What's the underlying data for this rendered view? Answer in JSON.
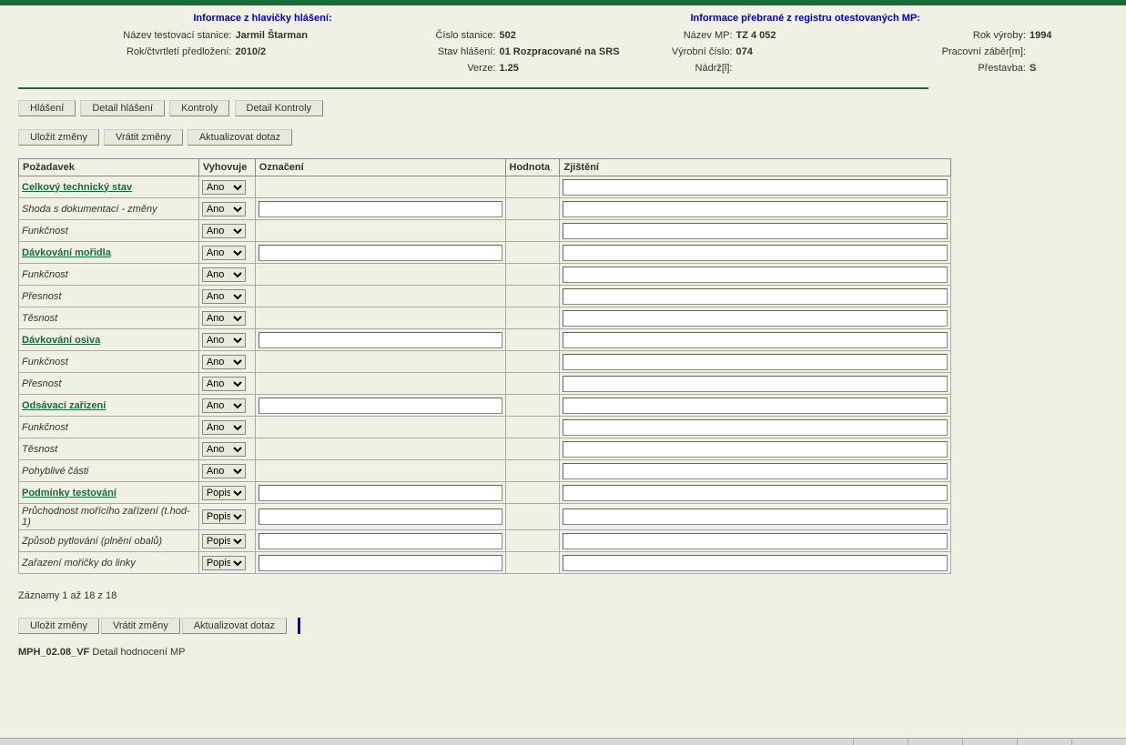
{
  "header": {
    "left_title": "Informace z hlavičky hlášení:",
    "right_title": "Informace přebrané z registru otestovaných MP:",
    "left_rows": [
      {
        "label": "Název testovací stanice:",
        "value": "Jarmil Štarman",
        "lw": 140
      },
      {
        "label": "Rok/čtvrtletí předložení:",
        "value": "2010/2",
        "lw": 140
      }
    ],
    "mid_rows": [
      {
        "label": "Číslo stanice:",
        "value": "502",
        "lw": 90
      },
      {
        "label": "Stav hlášení:",
        "value": "01 Rozpracované na SRS",
        "lw": 90
      },
      {
        "label": "Verze:",
        "value": "1.25",
        "lw": 90
      }
    ],
    "r1_rows": [
      {
        "label": "Název MP:",
        "value": "TZ 4 052",
        "lw": 90
      },
      {
        "label": "Výrobní číslo:",
        "value": "074",
        "lw": 90
      },
      {
        "label": "Nádrž[l]:",
        "value": "",
        "lw": 90
      }
    ],
    "r2_rows": [
      {
        "label": "Rok výroby:",
        "value": "1994",
        "lw": 120
      },
      {
        "label": "Pracovní záběr[m]:",
        "value": "",
        "lw": 120
      },
      {
        "label": "Přestavba:",
        "value": "S",
        "lw": 120
      }
    ]
  },
  "tabs": {
    "hlaseni": "Hlášení",
    "detail_hlaseni": "Detail hlášení",
    "kontroly": "Kontroly",
    "detail_kontroly": "Detail Kontroly"
  },
  "actions": {
    "ulozit": "Uložit změny",
    "vratit": "Vrátit změny",
    "aktualizovat": "Aktualizovat dotaz"
  },
  "table": {
    "headers": {
      "pozadavek": "Požadavek",
      "vyhovuje": "Vyhovuje",
      "oznaceni": "Označení",
      "hodnota": "Hodnota",
      "zjisteni": "Zjištění"
    },
    "rows": [
      {
        "label": "Celkový technický stav",
        "style": "section",
        "sel": "Ano",
        "ozn": false,
        "zj": true
      },
      {
        "label": "Shoda s dokumentací - změny",
        "style": "sub",
        "sel": "Ano",
        "ozn": true,
        "zj": true
      },
      {
        "label": "Funkčnost",
        "style": "sub",
        "sel": "Ano",
        "ozn": false,
        "zj": true
      },
      {
        "label": "Dávkování mořidla",
        "style": "section",
        "sel": "Ano",
        "ozn": true,
        "zj": true
      },
      {
        "label": "Funkčnost",
        "style": "sub",
        "sel": "Ano",
        "ozn": false,
        "zj": true
      },
      {
        "label": "Přesnost",
        "style": "sub",
        "sel": "Ano",
        "ozn": false,
        "zj": true
      },
      {
        "label": "Těsnost",
        "style": "sub",
        "sel": "Ano",
        "ozn": false,
        "zj": true
      },
      {
        "label": "Dávkování osiva",
        "style": "section",
        "sel": "Ano",
        "ozn": true,
        "zj": true
      },
      {
        "label": "Funkčnost",
        "style": "sub",
        "sel": "Ano",
        "ozn": false,
        "zj": true
      },
      {
        "label": "Přesnost",
        "style": "sub",
        "sel": "Ano",
        "ozn": false,
        "zj": true
      },
      {
        "label": "Odsávací zařízení",
        "style": "section",
        "sel": "Ano",
        "ozn": true,
        "zj": true
      },
      {
        "label": "Funkčnost",
        "style": "sub",
        "sel": "Ano",
        "ozn": false,
        "zj": true
      },
      {
        "label": "Těsnost",
        "style": "sub",
        "sel": "Ano",
        "ozn": false,
        "zj": true
      },
      {
        "label": "Pohyblivé části",
        "style": "sub",
        "sel": "Ano",
        "ozn": false,
        "zj": true
      },
      {
        "label": "Podmínky testování",
        "style": "section",
        "sel": "Popis",
        "ozn": true,
        "zj": true
      },
      {
        "label": "Průchodnost mořícího zařízení (t.hod-1)",
        "style": "sub",
        "sel": "Popis",
        "ozn": true,
        "zj": true
      },
      {
        "label": "Způsob pytlování (plnění obalů)",
        "style": "sub",
        "sel": "Popis",
        "ozn": true,
        "zj": true
      },
      {
        "label": "Zařazení mořičky do linky",
        "style": "sub",
        "sel": "Popis",
        "ozn": true,
        "zj": true
      }
    ]
  },
  "records_info": "Záznamy 1 až 18 z 18",
  "footer": {
    "code": "MPH_02.08_VF",
    "text": "Detail hodnocení MP"
  }
}
